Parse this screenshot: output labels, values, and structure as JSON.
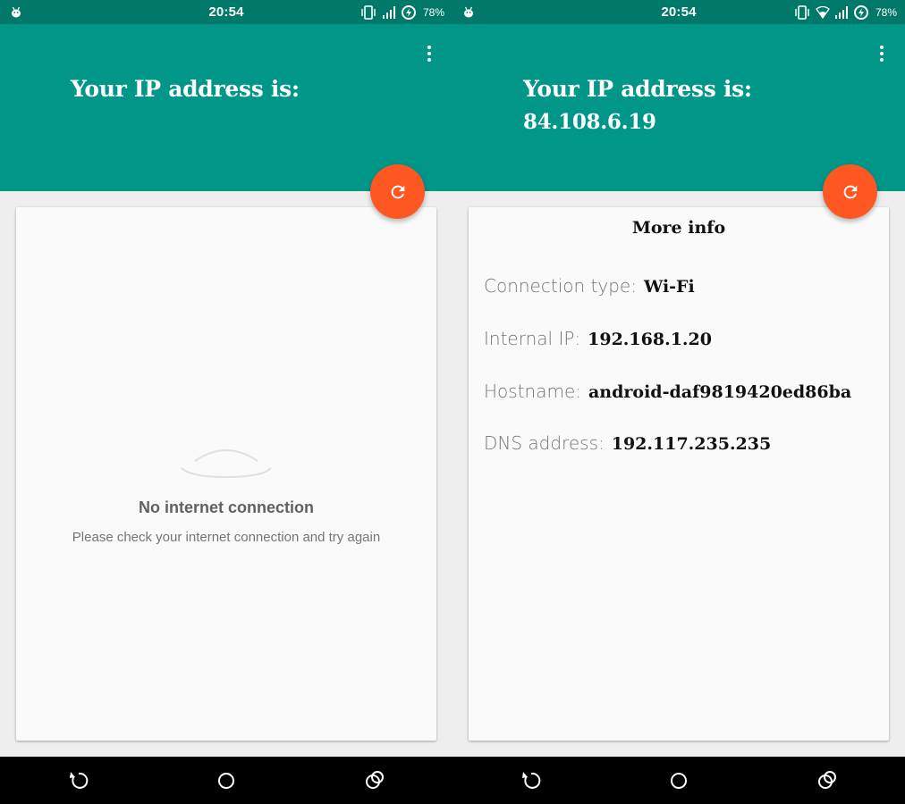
{
  "colors": {
    "statusbar": "#00796b",
    "appbar": "#009688",
    "fab": "#ff5722",
    "background": "#eeeeee",
    "card": "#fafafa"
  },
  "left": {
    "status": {
      "time": "20:54",
      "battery": "78%",
      "icons": [
        "android-debug-icon",
        "vibrate-icon",
        "signal-icon",
        "data-saver-icon"
      ]
    },
    "header": {
      "title": "Your IP address is:",
      "ip": ""
    },
    "refresh_icon": "refresh-icon",
    "menu_icon": "more-vert-icon",
    "error": {
      "title": "No internet connection",
      "message": "Please check your internet connection and try again"
    },
    "nav": {
      "icons": [
        "back-icon",
        "home-icon",
        "recents-icon"
      ]
    }
  },
  "right": {
    "status": {
      "time": "20:54",
      "battery": "78%",
      "icons": [
        "android-debug-icon",
        "vibrate-icon",
        "wifi-icon",
        "signal-icon",
        "data-saver-icon"
      ]
    },
    "header": {
      "title": "Your IP address is:",
      "ip": "84.108.6.19"
    },
    "refresh_icon": "refresh-icon",
    "menu_icon": "more-vert-icon",
    "more_info": {
      "title": "More info",
      "rows": [
        {
          "label": "Connection type:",
          "value": "Wi-Fi"
        },
        {
          "label": "Internal IP:",
          "value": "192.168.1.20"
        },
        {
          "label": "Hostname:",
          "value": "android-daf9819420ed86ba"
        },
        {
          "label": "DNS address:",
          "value": "192.117.235.235"
        }
      ]
    },
    "nav": {
      "icons": [
        "back-icon",
        "home-icon",
        "recents-icon"
      ]
    }
  }
}
